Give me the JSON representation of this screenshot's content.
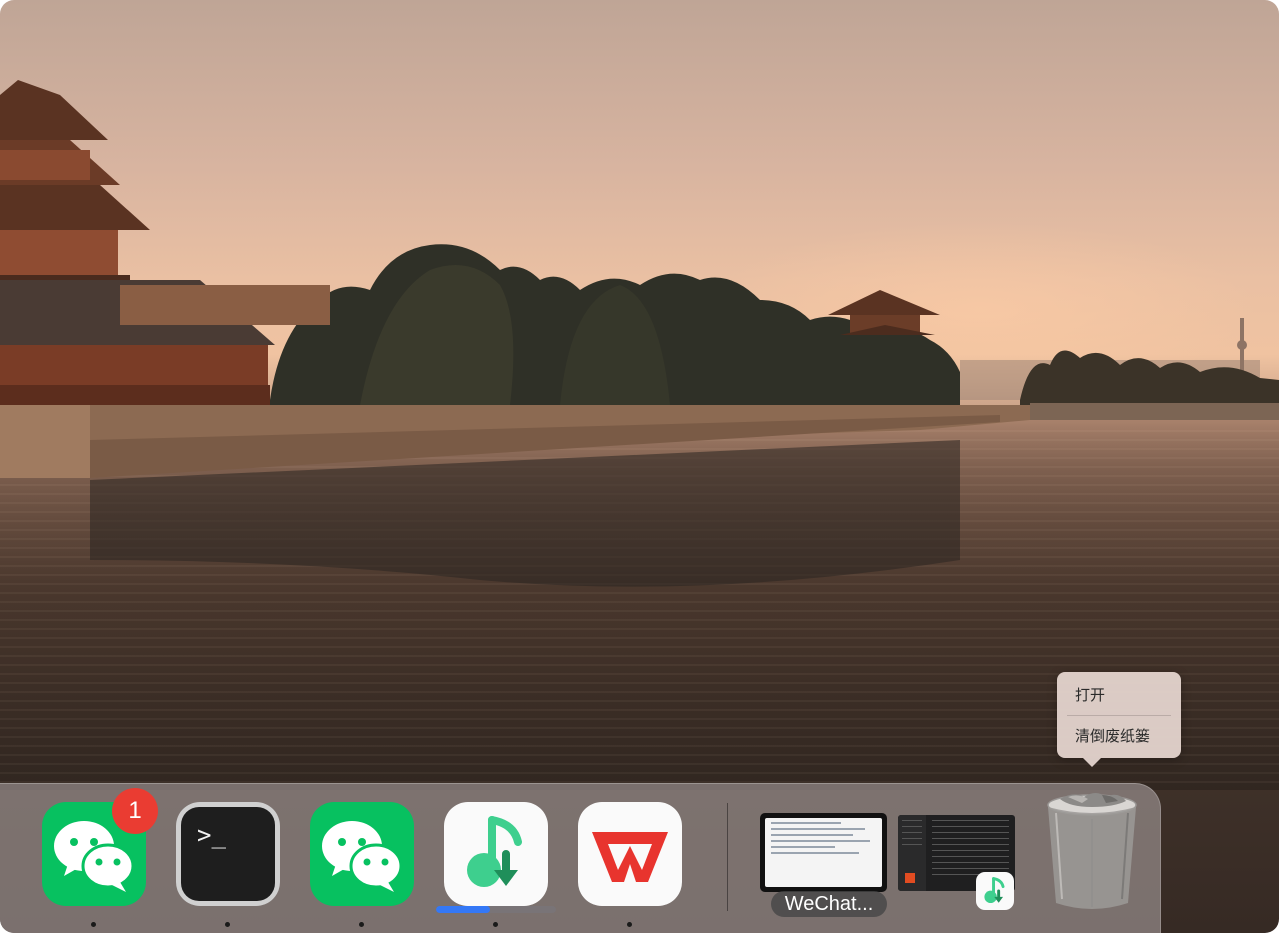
{
  "context_menu": {
    "items": [
      {
        "label": "打开"
      },
      {
        "label": "清倒废纸篓"
      }
    ]
  },
  "dock": {
    "apps": [
      {
        "name": "WeChat",
        "icon": "wechat-icon",
        "badge": "1",
        "running": true
      },
      {
        "name": "Terminal",
        "icon": "terminal-icon",
        "prompt": ">_",
        "running": true
      },
      {
        "name": "WeChat",
        "icon": "wechat-icon",
        "running": true
      },
      {
        "name": "Music Downloader",
        "icon": "music-download-icon",
        "running": true,
        "progress": 0.45
      },
      {
        "name": "WPS Office",
        "icon": "wps-icon",
        "running": true
      }
    ],
    "windows": [
      {
        "label": "WeChat...",
        "icon": "window-thumbnail"
      },
      {
        "icon": "music-window-thumbnail",
        "badge_icon": "music-download-icon"
      }
    ],
    "trash": {
      "icon": "trash-full-icon"
    }
  },
  "colors": {
    "wechat_green": "#07c160",
    "badge_red": "#ea3c32",
    "progress_blue": "#3478f6",
    "wps_red": "#e8342e",
    "music_green": "#3ecf8e"
  }
}
